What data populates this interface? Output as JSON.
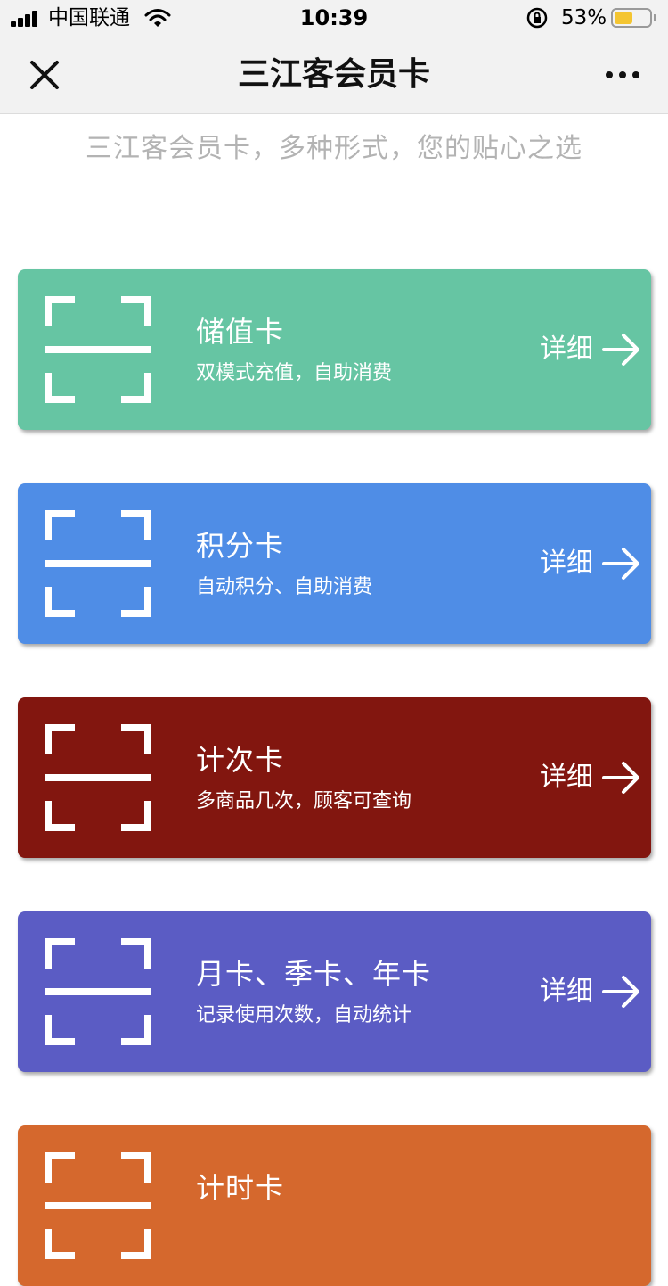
{
  "status_bar": {
    "carrier": "中国联通",
    "time": "10:39",
    "battery_percent_text": "53%",
    "battery_level": 0.53,
    "battery_color": "#f4c531"
  },
  "nav": {
    "title": "三江客会员卡",
    "close_icon": "close-icon",
    "more_icon": "more-icon"
  },
  "subtitle": "三江客会员卡，多种形式，您的贴心之选",
  "cards": [
    {
      "title": "储值卡",
      "desc": "双模式充值，自助消费",
      "detail": "详细",
      "color": "#66c5a3",
      "icon": "scan-icon"
    },
    {
      "title": "积分卡",
      "desc": "自动积分、自助消费",
      "detail": "详细",
      "color": "#4f8de6",
      "icon": "scan-icon"
    },
    {
      "title": "计次卡",
      "desc": "多商品几次，顾客可查询",
      "detail": "详细",
      "color": "#82160f",
      "icon": "scan-icon"
    },
    {
      "title": "月卡、季卡、年卡",
      "desc": "记录使用次数，自动统计",
      "detail": "详细",
      "color": "#5b5cc4",
      "icon": "scan-icon"
    },
    {
      "title": "计时卡",
      "desc": "",
      "detail": "",
      "color": "#d5682d",
      "icon": "scan-icon"
    }
  ]
}
